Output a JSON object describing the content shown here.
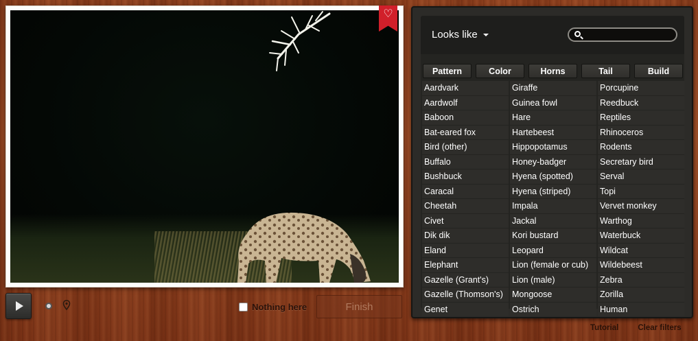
{
  "photo": {
    "favorite_icon": "heart-icon",
    "subject": "hyena-at-night"
  },
  "controls": {
    "play_icon": "play-icon",
    "nothing_here_label": "Nothing here",
    "nothing_here_checked": false,
    "finish_label": "Finish"
  },
  "panel": {
    "looks_like_label": "Looks like",
    "search": {
      "placeholder": "",
      "value": ""
    },
    "filters": [
      "Pattern",
      "Color",
      "Horns",
      "Tail",
      "Build"
    ],
    "columns": [
      [
        "Aardvark",
        "Aardwolf",
        "Baboon",
        "Bat-eared fox",
        "Bird (other)",
        "Buffalo",
        "Bushbuck",
        "Caracal",
        "Cheetah",
        "Civet",
        "Dik dik",
        "Eland",
        "Elephant",
        "Gazelle (Grant's)",
        "Gazelle (Thomson's)",
        "Genet"
      ],
      [
        "Giraffe",
        "Guinea fowl",
        "Hare",
        "Hartebeest",
        "Hippopotamus",
        "Honey-badger",
        "Hyena (spotted)",
        "Hyena (striped)",
        "Impala",
        "Jackal",
        "Kori bustard",
        "Leopard",
        "Lion (female or cub)",
        "Lion (male)",
        "Mongoose",
        "Ostrich"
      ],
      [
        "Porcupine",
        "Reedbuck",
        "Reptiles",
        "Rhinoceros",
        "Rodents",
        "Secretary bird",
        "Serval",
        "Topi",
        "Vervet monkey",
        "Warthog",
        "Waterbuck",
        "Wildcat",
        "Wildebeest",
        "Zebra",
        "Zorilla",
        "Human"
      ]
    ]
  },
  "footer": {
    "tutorial_label": "Tutorial",
    "clear_filters_label": "Clear filters"
  }
}
